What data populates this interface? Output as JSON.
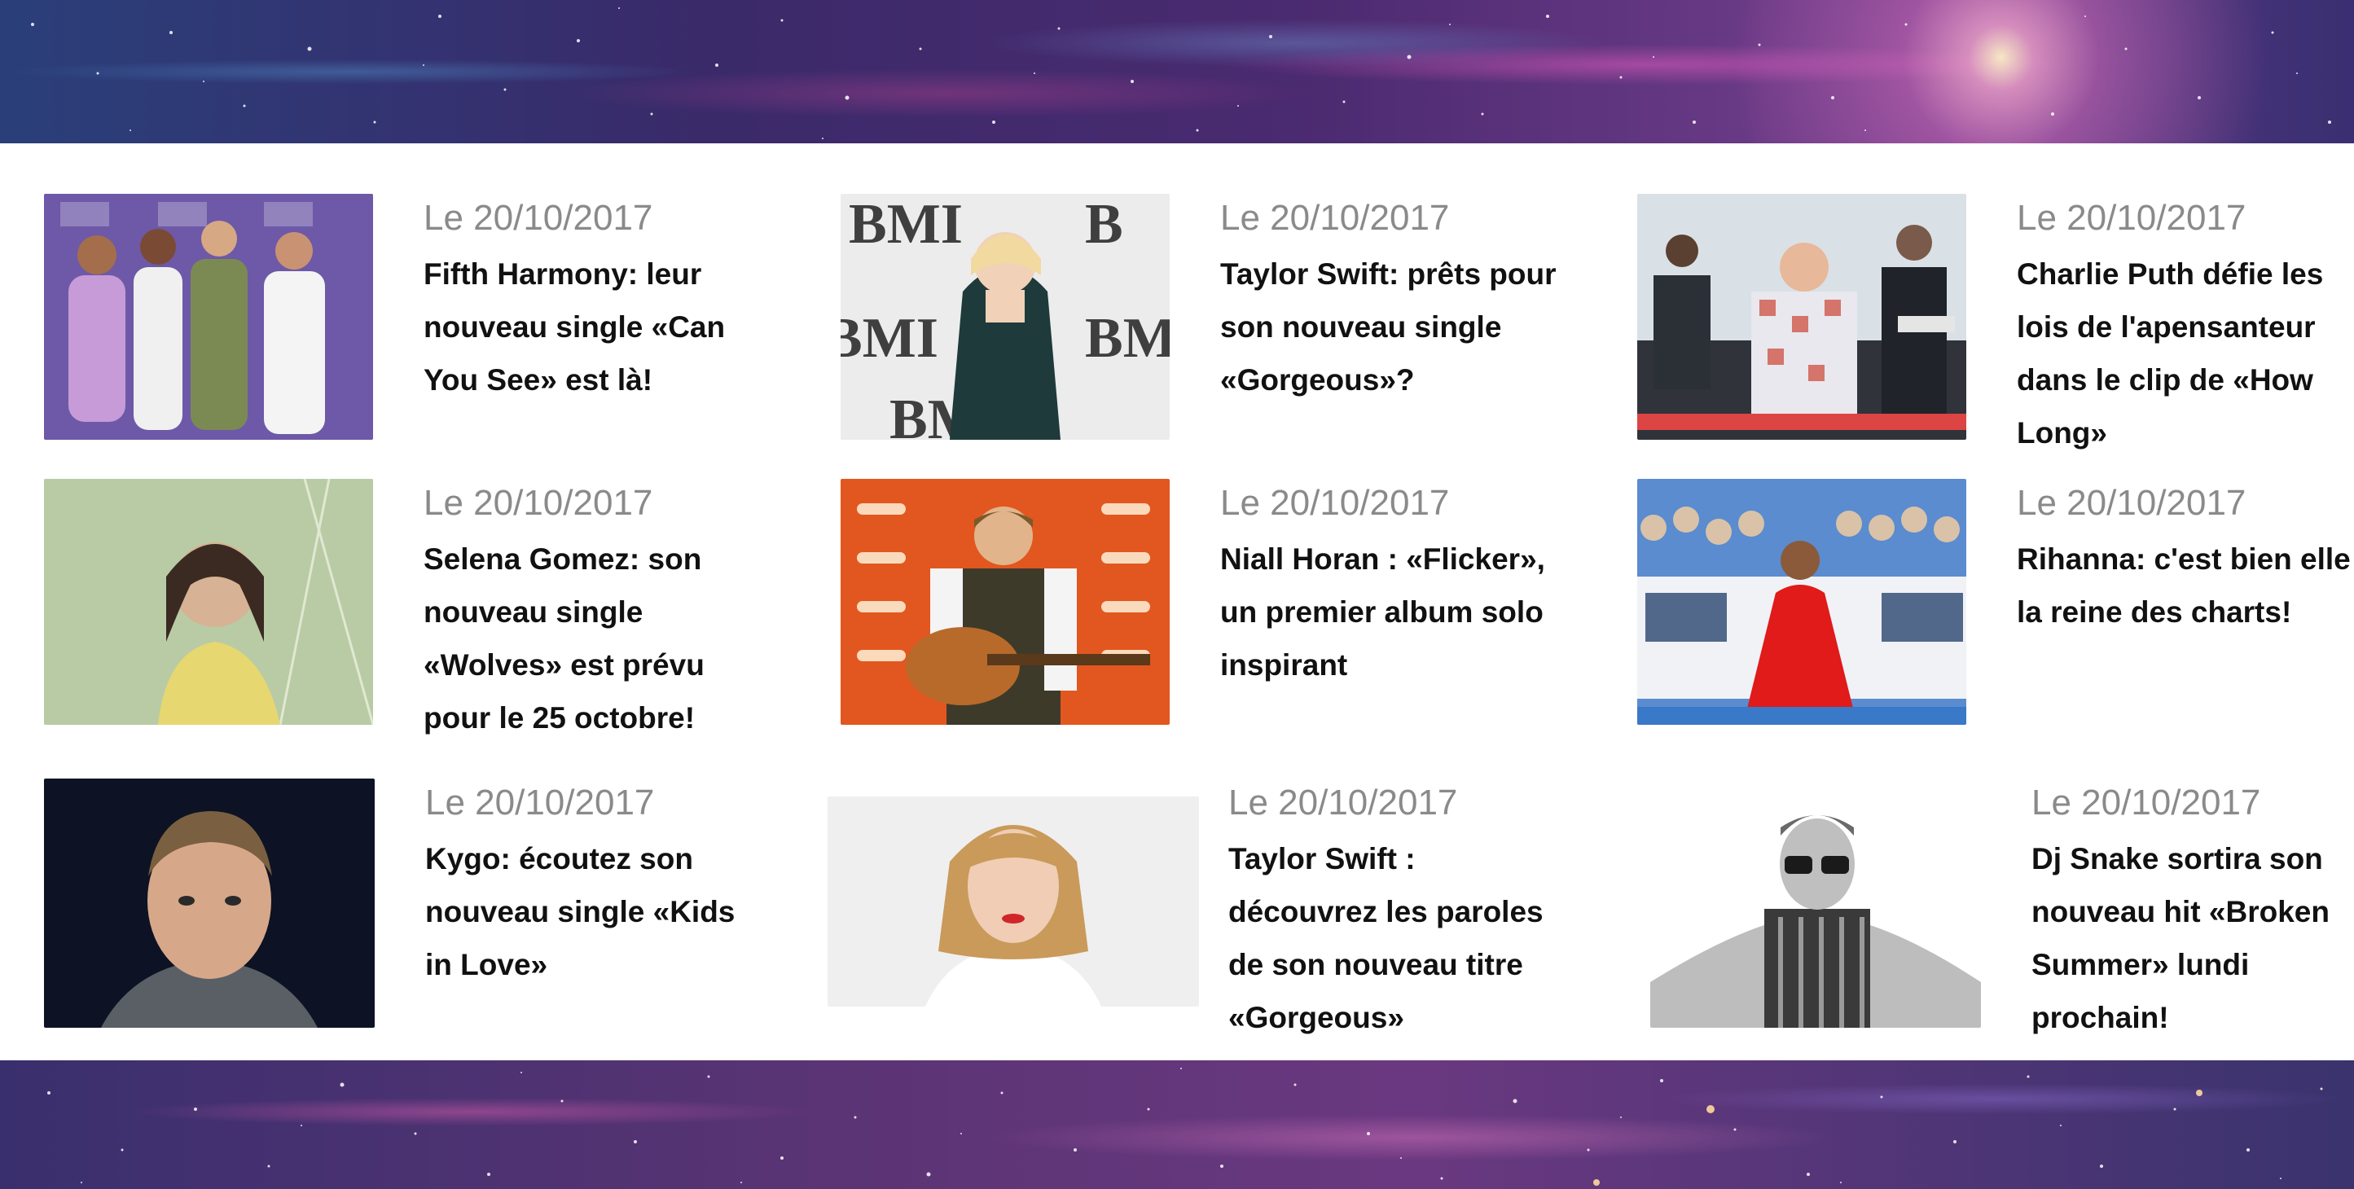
{
  "articles": [
    {
      "date": "Le 20/10/2017",
      "title": "Fifth Harmony: leur nouveau single «Can You See» est là!",
      "thumb_icon": "group-photo-icon"
    },
    {
      "date": "Le 20/10/2017",
      "title": "Taylor Swift: prêts pour son nouveau single «Gorgeous»?",
      "thumb_icon": "portrait-photo-icon"
    },
    {
      "date": "Le 20/10/2017",
      "title": "Charlie Puth défie les lois de l'apensanteur dans le clip de «How Long»",
      "thumb_icon": "concert-photo-icon"
    },
    {
      "date": "Le 20/10/2017",
      "title": "Selena Gomez: son nouveau single «Wolves» est prévu pour le 25 octobre!",
      "thumb_icon": "portrait-photo-icon"
    },
    {
      "date": "Le 20/10/2017",
      "title": "Niall Horan : «Flicker», un premier album solo inspirant",
      "thumb_icon": "guitar-photo-icon"
    },
    {
      "date": "Le 20/10/2017",
      "title": "Rihanna: c'est bien elle la reine des charts!",
      "thumb_icon": "red-carpet-photo-icon"
    },
    {
      "date": "Le 20/10/2017",
      "title": "Kygo: écoutez son nouveau single «Kids in Love»",
      "thumb_icon": "portrait-photo-icon"
    },
    {
      "date": "Le 20/10/2017",
      "title": "Taylor Swift : découvrez les paroles de son nouveau titre «Gorgeous»",
      "thumb_icon": "portrait-photo-icon"
    },
    {
      "date": "Le 20/10/2017",
      "title": "Dj Snake sortira son nouveau hit «Broken Summer» lundi prochain!",
      "thumb_icon": "portrait-photo-icon"
    }
  ],
  "colors": {
    "date_text": "#8a8a8a",
    "title_text": "#111111",
    "background": "#ffffff",
    "galaxy_pink": "#d85ab4",
    "galaxy_blue": "#2a3f7a"
  }
}
